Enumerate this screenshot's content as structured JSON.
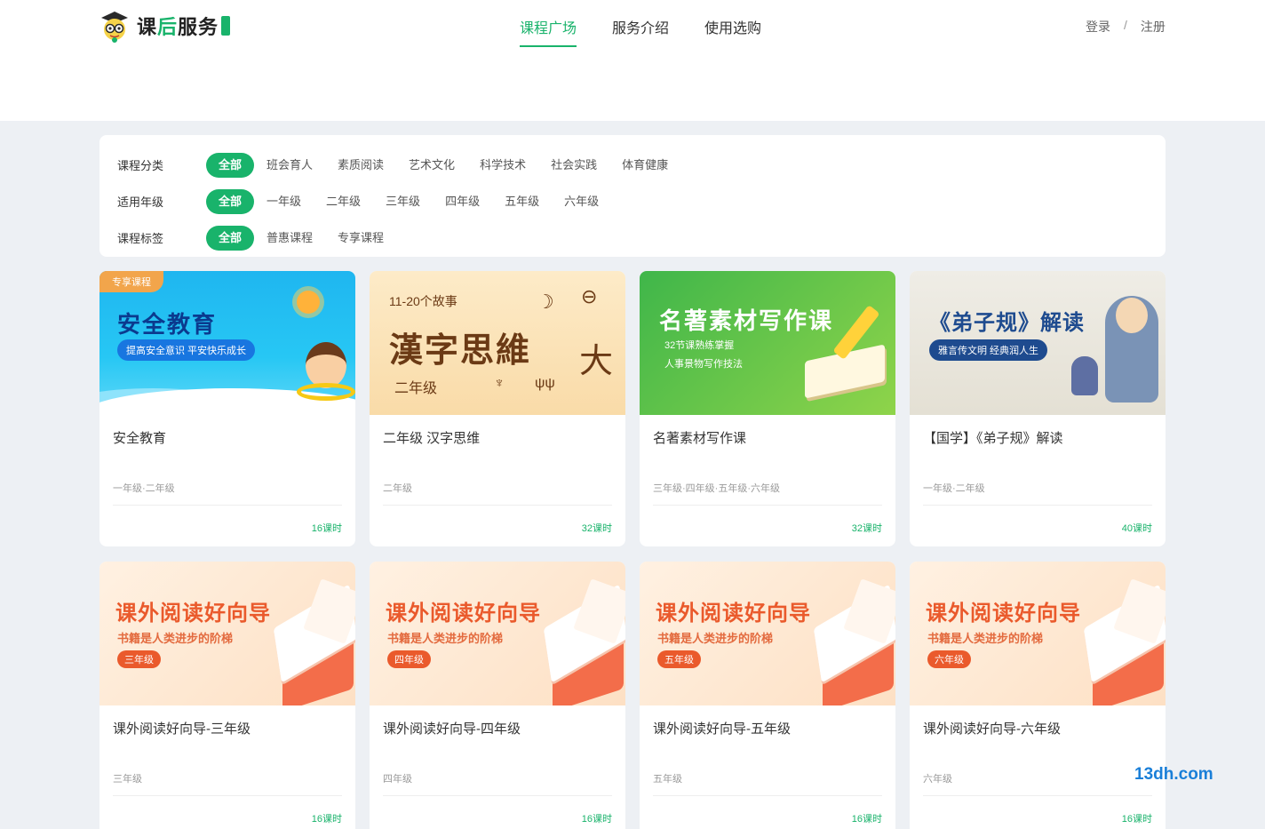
{
  "header": {
    "logo_text_1": "课",
    "logo_text_2": "后",
    "logo_text_3": "服务",
    "nav": [
      {
        "label": "课程广场",
        "active": true
      },
      {
        "label": "服务介绍",
        "active": false
      },
      {
        "label": "使用选购",
        "active": false
      }
    ],
    "login": "登录",
    "separator": "/",
    "register": "注册"
  },
  "filters": [
    {
      "label": "课程分类",
      "options": [
        "全部",
        "班会育人",
        "素质阅读",
        "艺术文化",
        "科学技术",
        "社会实践",
        "体育健康"
      ]
    },
    {
      "label": "适用年级",
      "options": [
        "全部",
        "一年级",
        "二年级",
        "三年级",
        "四年级",
        "五年级",
        "六年级"
      ]
    },
    {
      "label": "课程标签",
      "options": [
        "全部",
        "普惠课程",
        "专享课程"
      ]
    }
  ],
  "cards": [
    {
      "title": "安全教育",
      "grades": "一年级·二年级",
      "hours": "16课时",
      "thumb": {
        "corner_tag": "专享课程",
        "heading": "安全教育",
        "tagline": "提高安全意识 平安快乐成长"
      }
    },
    {
      "title": "二年级 汉字思维",
      "grades": "二年级",
      "hours": "32课时",
      "thumb": {
        "sub": "11-20个故事",
        "heading": "漢字思維",
        "grade": "二年级"
      }
    },
    {
      "title": "名著素材写作课",
      "grades": "三年级·四年级·五年级·六年级",
      "hours": "32课时",
      "thumb": {
        "heading": "名著素材写作课",
        "line1": "32节课熟练掌握",
        "line2": "人事景物写作技法"
      }
    },
    {
      "title": "【国学】《弟子规》解读",
      "grades": "一年级·二年级",
      "hours": "40课时",
      "thumb": {
        "heading": "《弟子规》解读",
        "tagline": "雅言传文明 经典润人生"
      }
    },
    {
      "title": "课外阅读好向导-三年级",
      "grades": "三年级",
      "hours": "16课时",
      "thumb": {
        "heading": "课外阅读好向导",
        "sub": "书籍是人类进步的阶梯",
        "badge": "三年级"
      }
    },
    {
      "title": "课外阅读好向导-四年级",
      "grades": "四年级",
      "hours": "16课时",
      "thumb": {
        "heading": "课外阅读好向导",
        "sub": "书籍是人类进步的阶梯",
        "badge": "四年级"
      }
    },
    {
      "title": "课外阅读好向导-五年级",
      "grades": "五年级",
      "hours": "16课时",
      "thumb": {
        "heading": "课外阅读好向导",
        "sub": "书籍是人类进步的阶梯",
        "badge": "五年级"
      }
    },
    {
      "title": "课外阅读好向导-六年级",
      "grades": "六年级",
      "hours": "16课时",
      "thumb": {
        "heading": "课外阅读好向导",
        "sub": "书籍是人类进步的阶梯",
        "badge": "六年级"
      }
    }
  ],
  "watermark": "13dh.com",
  "colors": {
    "accent": "#19b36b",
    "background": "#edf0f4"
  }
}
